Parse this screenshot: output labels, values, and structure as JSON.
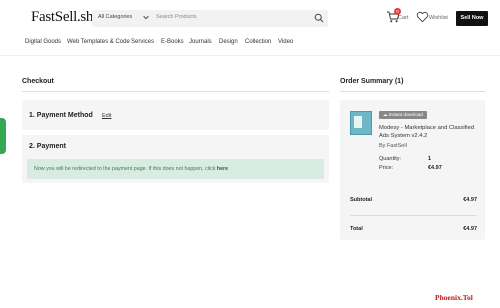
{
  "header": {
    "logo": "FastSell.shop",
    "search": {
      "category": "All Categories",
      "placeholder": "Search Products"
    },
    "cart": {
      "label": "Cart",
      "count": "0"
    },
    "wishlist_label": "Wishlist",
    "sell_now_label": "Sell Now"
  },
  "nav": [
    "Digital Goods",
    "Web Templates & Code",
    "Services",
    "E-Books",
    "Journals",
    "Design",
    "Collection",
    "Video"
  ],
  "checkout": {
    "title": "Checkout",
    "step1": {
      "title": "1.  Payment Method",
      "edit": "Edit"
    },
    "step2": {
      "title": "2.  Payment",
      "message": "Now you will be redirected to the payment page. If this does not happen, click",
      "link": "here"
    }
  },
  "summary": {
    "title": "Order Summary (1)",
    "badge": "Instant download",
    "product_title_line1": "Modesy - Marketplace and Classified",
    "product_title_line2": "Ads System v2.4.2",
    "byline": "By FastSell",
    "quantity_label": "Quantity:",
    "quantity": "1",
    "price_label": "Price:",
    "price": "€4.97",
    "subtotal_label": "Subtotal",
    "subtotal": "€4.97",
    "total_label": "Total",
    "total": "€4.97"
  },
  "watermark": "Phoenix.Tol",
  "colors": {
    "accent": "#111111",
    "success_bg": "#d9ece1",
    "success_text": "#3f7b56",
    "cart_badge": "#e03a3a",
    "side_tab": "#34a853"
  }
}
